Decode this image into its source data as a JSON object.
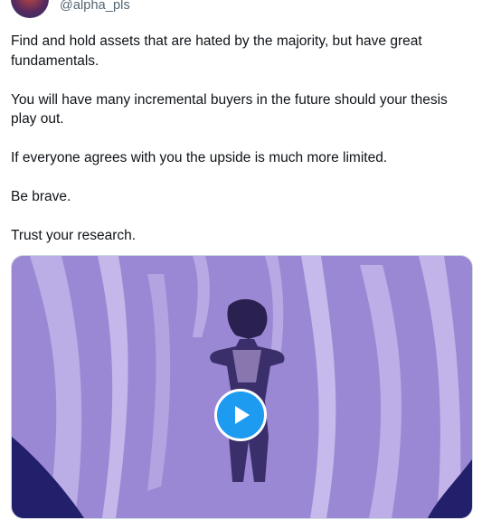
{
  "author": {
    "handle": "@alpha_pls"
  },
  "tweet": {
    "paragraphs": [
      "Find and hold assets that are hated by the majority, but have great fundamentals.",
      "You will have many incremental buyers in the future should your thesis play out.",
      "If everyone agrees with you the upside is much more limited.",
      "Be brave.",
      "Trust your research."
    ]
  },
  "media": {
    "type": "video",
    "play_icon": "play-icon",
    "accent": "#1d9bf0",
    "tint": "#9a86d2"
  }
}
